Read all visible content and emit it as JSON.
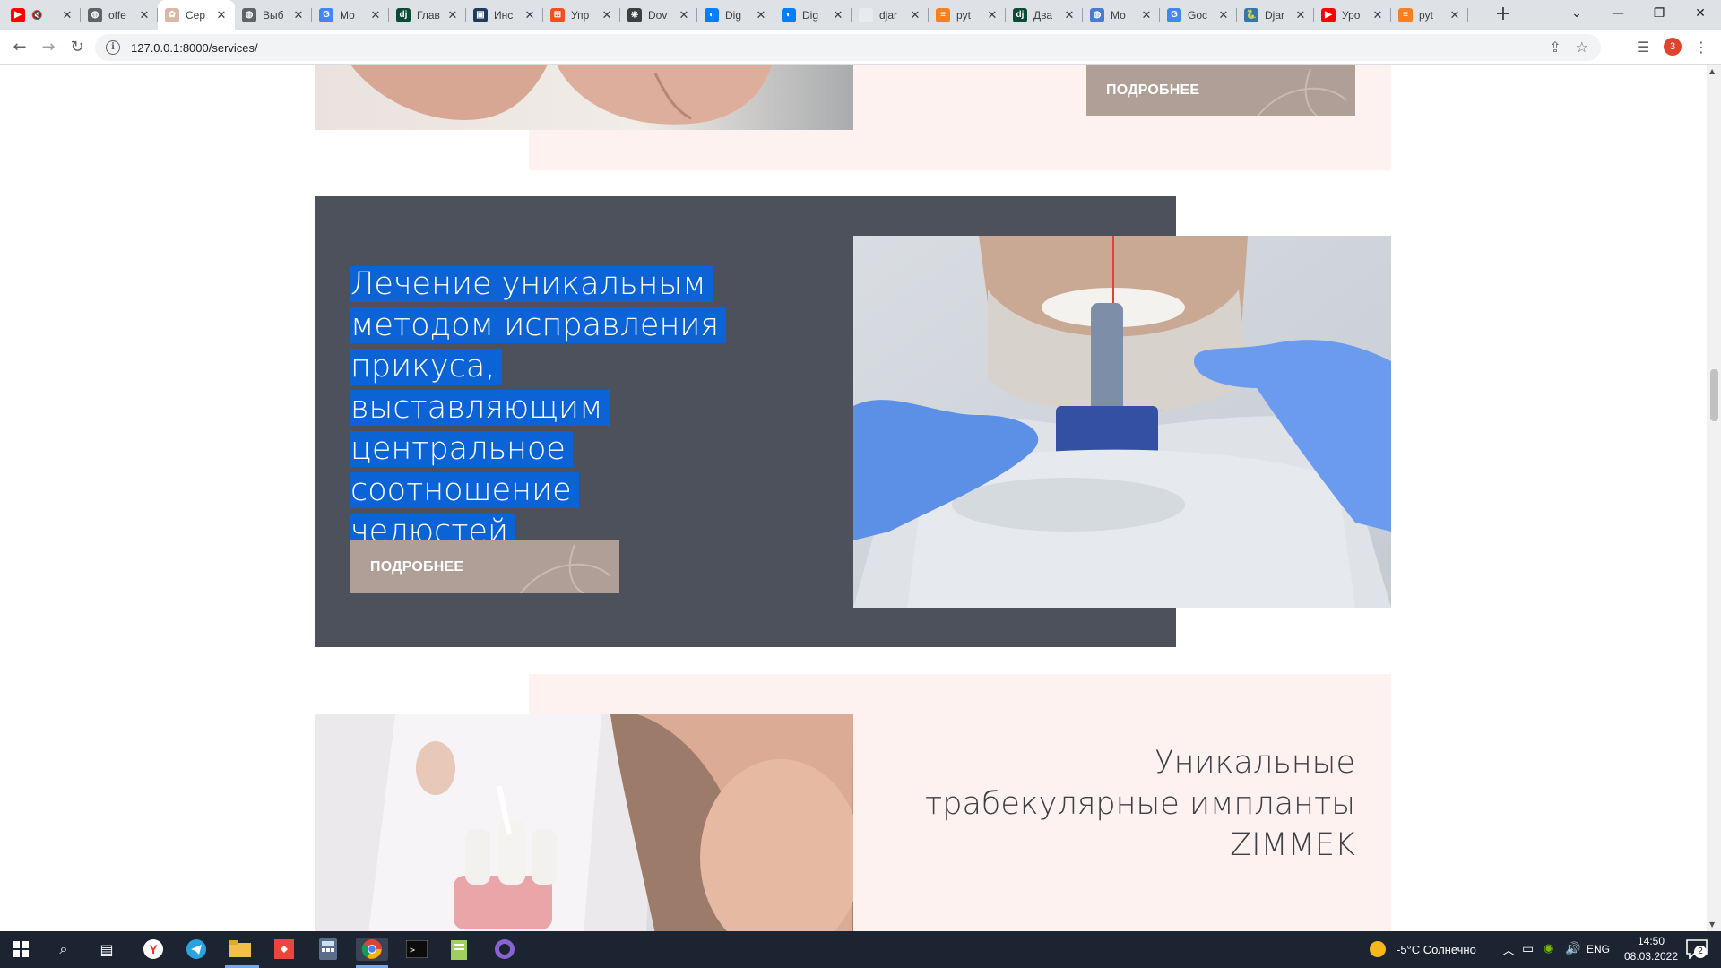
{
  "browser": {
    "tabs": [
      {
        "title": "",
        "favicon": "youtube-icon",
        "color": "#ff0000",
        "glyph": "▶",
        "muted": true
      },
      {
        "title": "offe",
        "favicon": "globe-icon",
        "color": "#5f6368",
        "glyph": "◍"
      },
      {
        "title": "Сер",
        "favicon": "site-icon",
        "color": "#d9b8a8",
        "glyph": "✿",
        "active": true
      },
      {
        "title": "Выб",
        "favicon": "globe-icon",
        "color": "#5f6368",
        "glyph": "◍"
      },
      {
        "title": "Мо",
        "favicon": "google-icon",
        "color": "#4285f4",
        "glyph": "G"
      },
      {
        "title": "Глав",
        "favicon": "django-icon",
        "color": "#0c4b33",
        "glyph": "dj"
      },
      {
        "title": "Инс",
        "favicon": "terminal-icon",
        "color": "#1e3a5f",
        "glyph": "▣"
      },
      {
        "title": "Упр",
        "favicon": "windows-icon",
        "color": "#f25022",
        "glyph": "⊞"
      },
      {
        "title": "Dov",
        "favicon": "python-docs-icon",
        "color": "#3c4043",
        "glyph": "⎈"
      },
      {
        "title": "Dig",
        "favicon": "digitalocean-icon",
        "color": "#0080ff",
        "glyph": "◐"
      },
      {
        "title": "Dig",
        "favicon": "digitalocean-icon",
        "color": "#0080ff",
        "glyph": "◐"
      },
      {
        "title": "djar",
        "favicon": "blank-page-icon",
        "color": "#e8eaed",
        "glyph": " "
      },
      {
        "title": "pyt",
        "favicon": "stackoverflow-icon",
        "color": "#f48024",
        "glyph": "≡"
      },
      {
        "title": "Два",
        "favicon": "django-icon",
        "color": "#0c4b33",
        "glyph": "dj"
      },
      {
        "title": "Мо",
        "favicon": "globe-blue-icon",
        "color": "#4a7bd0",
        "glyph": "◍"
      },
      {
        "title": "Goc",
        "favicon": "google-translate-icon",
        "color": "#4285f4",
        "glyph": "G"
      },
      {
        "title": "Djar",
        "favicon": "python-icon",
        "color": "#3776ab",
        "glyph": "🐍"
      },
      {
        "title": "Уро",
        "favicon": "youtube-icon",
        "color": "#ff0000",
        "glyph": "▶"
      },
      {
        "title": "pyt",
        "favicon": "stackoverflow-icon",
        "color": "#f48024",
        "glyph": "≡"
      }
    ],
    "new_tab": "+",
    "url": "127.0.0.1:8000/services/",
    "profile_count": "3"
  },
  "page": {
    "more_label": "ПОДРОБНЕЕ",
    "service_2_title": "Лечение уникальным методом исправления прикуса, выставляющим центральное соотношение челюстей",
    "service_3_title": "Уникальные трабекулярные импланты ZIMMEK"
  },
  "taskbar": {
    "weather": "-5°C  Солнечно",
    "lang": "ENG",
    "time": "14:50",
    "date": "08.03.2022",
    "notifications": "2"
  },
  "colors": {
    "accent_button": "#b09f97",
    "dark_panel": "#4d515c",
    "pink_panel": "#fdf2ef",
    "selection": "#0b63d6"
  }
}
